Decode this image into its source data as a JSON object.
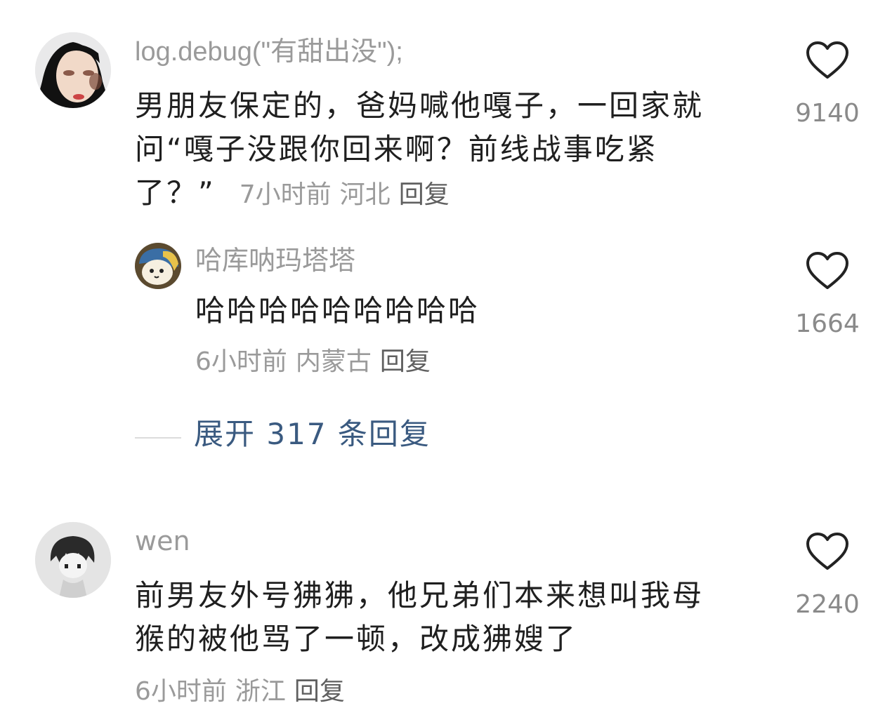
{
  "comments": [
    {
      "username": "log.debug(\"有甜出没\");",
      "text_lines": [
        "男朋友保定的，爸妈喊他嘎子，一回家就",
        "问“嘎子没跟你回来啊？前线战事吃紧",
        "了？”"
      ],
      "time": "7小时前",
      "location": "河北",
      "reply_label": "回复",
      "likes": "9140",
      "avatar_icon": "user-avatar-icon"
    },
    {
      "username": "哈库呐玛塔塔",
      "text_lines": [
        "哈哈哈哈哈哈哈哈哈"
      ],
      "time": "6小时前",
      "location": "内蒙古",
      "reply_label": "回复",
      "likes": "1664",
      "avatar_icon": "cartoon-avatar-icon"
    },
    {
      "username": "wen",
      "text_lines": [
        "前男友外号狒狒，他兄弟们本来想叫我母",
        "猴的被他骂了一顿，改成狒嫂了"
      ],
      "time": "6小时前",
      "location": "浙江",
      "reply_label": "回复",
      "likes": "2240",
      "avatar_icon": "anime-avatar-icon"
    }
  ],
  "expand_replies": "展开 317 条回复",
  "icons": {
    "like": "heart-icon"
  },
  "colors": {
    "username": "#9a9a9a",
    "text": "#1f1f1f",
    "meta": "#9a9a9a",
    "expand": "#3a5a80"
  }
}
